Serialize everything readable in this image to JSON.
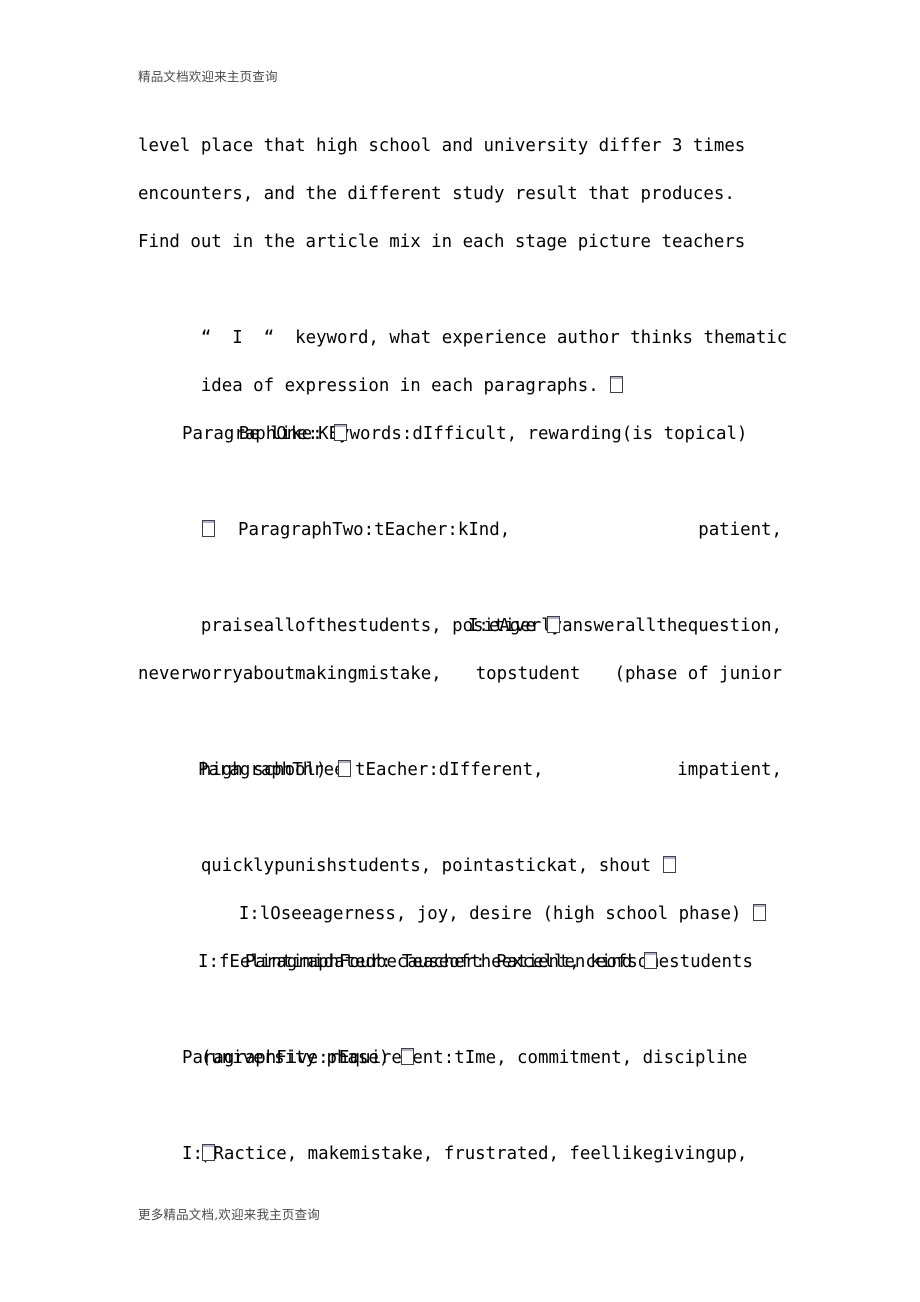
{
  "document": {
    "header_watermark": "精品文档欢迎来主页查询",
    "footer_watermark": "更多精品文档,欢迎来我主页查询",
    "lines": {
      "l01": "level place that high school and university differ 3 times",
      "l02": "encounters, and the different study result that produces.",
      "l03": "Find out in the article mix in each stage picture teachers",
      "l04_quote_open": "“",
      "l04_keyword_letter": "I",
      "l04_quote_close": "“",
      "l04_rest": "keyword, what experience author thinks thematic",
      "l05": "idea of expression in each paragraphs.",
      "l06": "Be like:",
      "l07": "ParagraphOne:KEywords:dIfficult, rewarding(is topical)",
      "l08": "",
      "l09_left": "ParagraphTwo:tEacher:kInd,",
      "l09_right": "patient,",
      "l10": "praiseallofthestudents, positive",
      "l11": "I:eAgerlyanswerallthequestion,",
      "l12_a": "neverworryaboutmakingmistake,",
      "l12_b": "topstudent",
      "l12_c": "(phase of junior",
      "l13": "high school)",
      "l14_left": "ParagraphThree:tEacher:dIfferent,",
      "l14_right": "impatient,",
      "l15": "quicklypunishstudents, pointastickat, shout",
      "l16": "I:lOseeagerness, joy, desire (high school phase)",
      "l17": "ParagraphFour: Teacher: Patient, kind",
      "l18": "I:fEelintimidatedbecauseoftheexcellenceofsomestudents",
      "l19": "(university phase)",
      "l20": "ParagraphFive:rEquirement:tIme, commitment, discipline",
      "l21": "",
      "l22": "I:pRactice, makemistake, frustrated, feellikegivingup,"
    }
  },
  "colors": {
    "text": "#000000",
    "watermark": "#4a4a4a",
    "tofu_border": "#3f3f46",
    "tofu_accent": "#b8aecb",
    "page_background": "#ffffff"
  }
}
